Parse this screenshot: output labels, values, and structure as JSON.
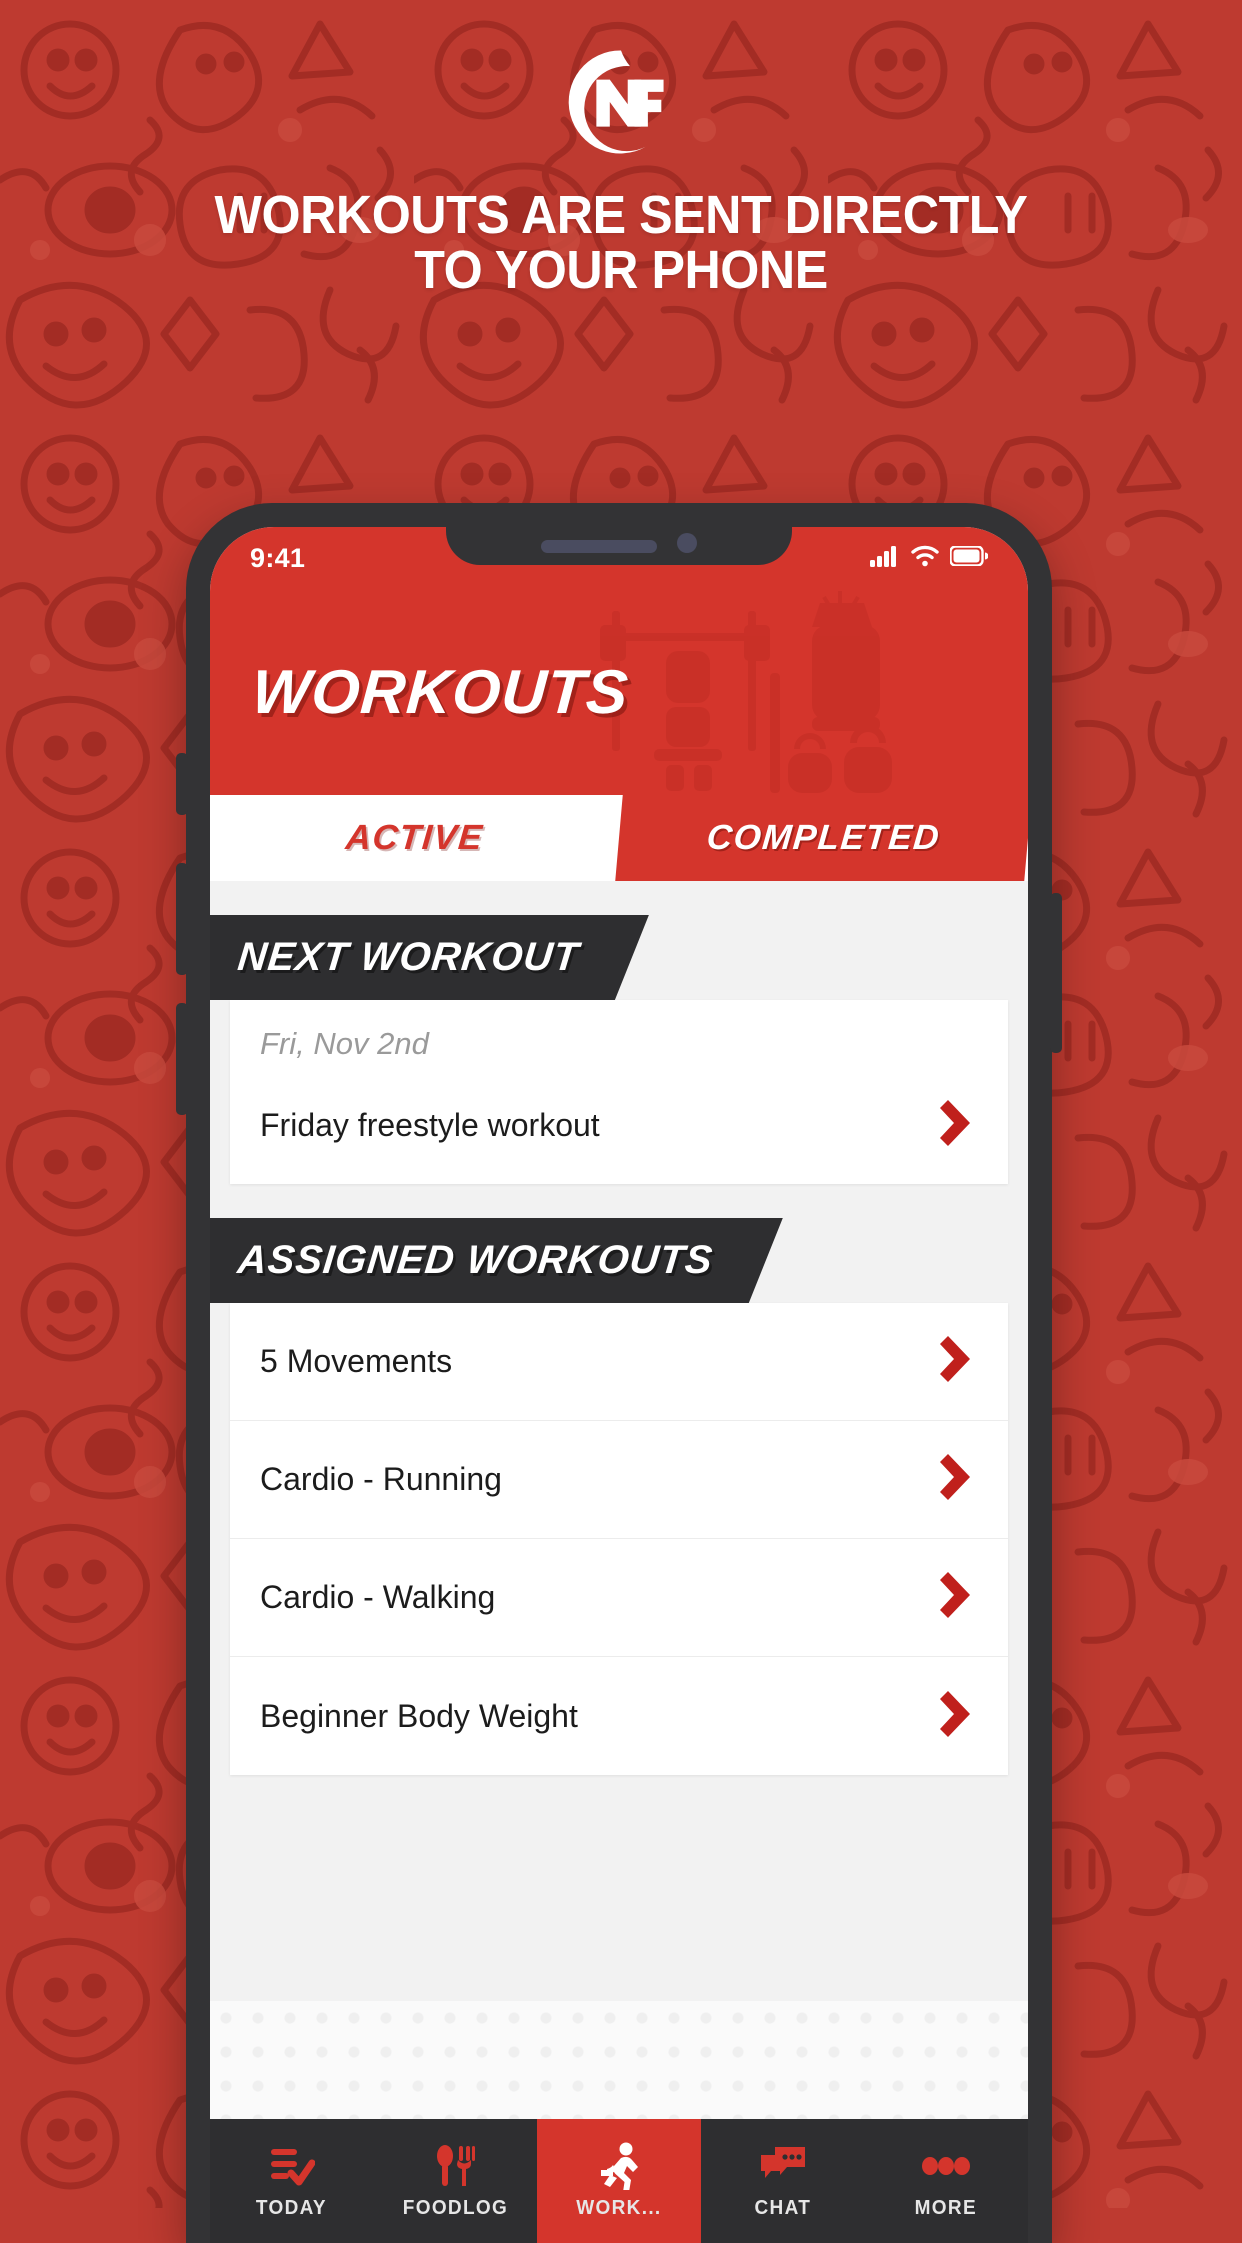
{
  "hero": {
    "logo_icon": "nf-logo-icon",
    "headline_line1": "WORKOUTS ARE SENT DIRECTLY",
    "headline_line2": "TO YOUR PHONE"
  },
  "colors": {
    "brand_red": "#D4352C",
    "background_red": "#BE3A30",
    "dark": "#2E2E30",
    "phone_frame": "#333335"
  },
  "phone": {
    "status_bar": {
      "time": "9:41",
      "icons": [
        "cellular-signal-icon",
        "wifi-icon",
        "battery-icon"
      ]
    },
    "app_header": {
      "title": "WORKOUTS"
    },
    "tabs": [
      {
        "label": "ACTIVE",
        "selected": true
      },
      {
        "label": "COMPLETED",
        "selected": false
      }
    ],
    "sections": [
      {
        "banner": "NEXT WORKOUT",
        "date": "Fri, Nov 2nd",
        "rows": [
          {
            "label": "Friday freestyle workout",
            "chevron": "chevron-right-icon"
          }
        ]
      },
      {
        "banner": "ASSIGNED WORKOUTS",
        "rows": [
          {
            "label": "5 Movements",
            "chevron": "chevron-right-icon"
          },
          {
            "label": "Cardio - Running",
            "chevron": "chevron-right-icon"
          },
          {
            "label": "Cardio - Walking",
            "chevron": "chevron-right-icon"
          },
          {
            "label": "Beginner Body Weight",
            "chevron": "chevron-right-icon"
          }
        ]
      }
    ],
    "bottom_nav": [
      {
        "label": "TODAY",
        "icon": "checklist-icon",
        "active": false
      },
      {
        "label": "FOODLOG",
        "icon": "spoon-fork-icon",
        "active": false
      },
      {
        "label": "WORK...",
        "icon": "running-person-icon",
        "active": true
      },
      {
        "label": "CHAT",
        "icon": "speech-bubbles-icon",
        "active": false
      },
      {
        "label": "MORE",
        "icon": "three-dots-icon",
        "active": false
      }
    ]
  }
}
